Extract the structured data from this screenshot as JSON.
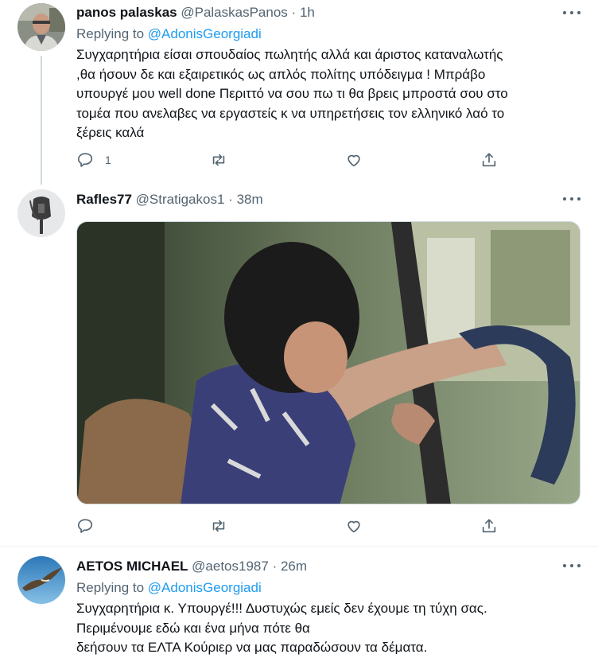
{
  "tweets": [
    {
      "display_name": "panos palaskas",
      "handle": "@PalaskasPanos",
      "separator": "·",
      "time": "1h",
      "replying_label": "Replying to",
      "replying_to": "@AdonisGeorgiadi",
      "text_lines": [
        "Συγχαρητήρια είσαι σπουδαίος πωλητής αλλά και άριστος καταναλωτής",
        ",θα ήσουν δε και εξαιρετικός ως απλός πολίτης υπόδειγμα ! Μπράβο",
        "υπουργέ μου well done Περιττό να σου πω τι θα βρεις μπροστά σου στο",
        "τομέα που ανελαβες να εργαστείς κ να υπηρετήσεις τον ελληνικό λαό το",
        "ξέρεις καλά"
      ],
      "reply_count": "1",
      "avatar_icon": "user-photo-avatar"
    },
    {
      "display_name": "Rafles77",
      "handle": "@Stratigakos1",
      "separator": "·",
      "time": "38m",
      "media_type": "gif",
      "avatar_icon": "mask-avatar"
    },
    {
      "display_name": "AETOS MICHAEL",
      "handle": "@aetos1987",
      "separator": "·",
      "time": "26m",
      "replying_label": "Replying to",
      "replying_to": "@AdonisGeorgiadi",
      "text_lines": [
        "Συγχαρητήρια κ. Υπουργέ!!! Δυστυχώς εμείς δεν έχουμε τη τύχη σας.",
        "Περιμένουμε εδώ και ένα μήνα πότε θα",
        "δεήσουν τα ΕΛΤΑ Κούριερ να μας παραδώσουν τα δέματα."
      ],
      "avatar_icon": "eagle-avatar"
    }
  ],
  "colors": {
    "text_primary": "#0f1419",
    "text_secondary": "#536471",
    "accent": "#1d9bf0",
    "divider": "#eff3f4"
  },
  "action_icons": [
    "reply-icon",
    "retweet-icon",
    "like-icon",
    "share-icon"
  ]
}
